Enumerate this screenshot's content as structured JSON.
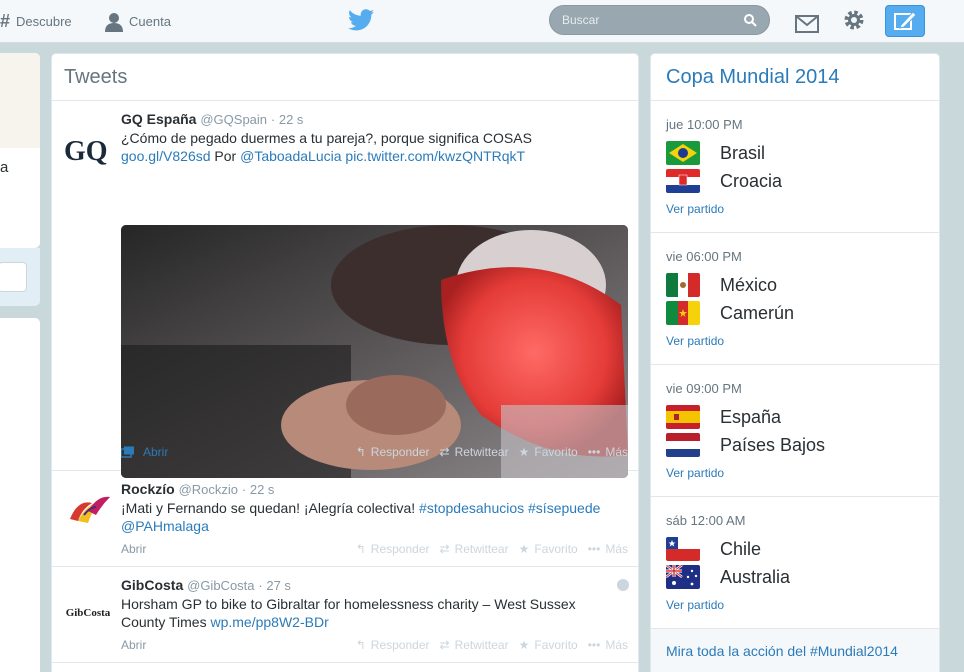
{
  "topbar": {
    "discover_label": "Descubre",
    "account_label": "Cuenta",
    "search_placeholder": "Buscar"
  },
  "left": {
    "letter": "a"
  },
  "timeline": {
    "title": "Tweets",
    "tweets": [
      {
        "name": "GQ España",
        "handle": "@GQSpain",
        "time": "· 22 s",
        "text": "¿Cómo de pegado duermes a tu pareja?, porque significa COSAS",
        "link1": "goo.gl/V826sd",
        "mid": " Por ",
        "link2": "@TaboadaLucia",
        "link3": "pic.twitter.com/kwzQNTRqkT",
        "open": "Abrir"
      },
      {
        "name": "Rockzío",
        "handle": "@Rockzio",
        "time": "· 22 s",
        "text": "¡Mati y Fernando se quedan! ¡Alegría colectiva! ",
        "link1": "#stopdesahucios",
        "link2": "#sísepuede",
        "link3": "@PAHmalaga",
        "open": "Abrir"
      },
      {
        "name": "GibCosta",
        "handle": "@GibCosta",
        "time": "· 27 s",
        "text": "Horsham GP to bike to Gibraltar for homelessness charity – West Sussex County Times ",
        "link1": "wp.me/pp8W2-BDr",
        "avatar_text": "GibCosta",
        "open": "Abrir"
      }
    ],
    "actions": {
      "reply": "Responder",
      "retweet": "Retwittear",
      "favorite": "Favorito",
      "more": "Más"
    }
  },
  "worldcup": {
    "title": "Copa Mundial 2014",
    "view_label": "Ver partido",
    "footer": "Mira toda la acción del #Mundial2014",
    "matches": [
      {
        "time": "jue 10:00 PM",
        "home": "Brasil",
        "away": "Croacia"
      },
      {
        "time": "vie 06:00 PM",
        "home": "México",
        "away": "Camerún"
      },
      {
        "time": "vie 09:00 PM",
        "home": "España",
        "away": "Países Bajos"
      },
      {
        "time": "sáb 12:00 AM",
        "home": "Chile",
        "away": "Australia"
      }
    ]
  }
}
